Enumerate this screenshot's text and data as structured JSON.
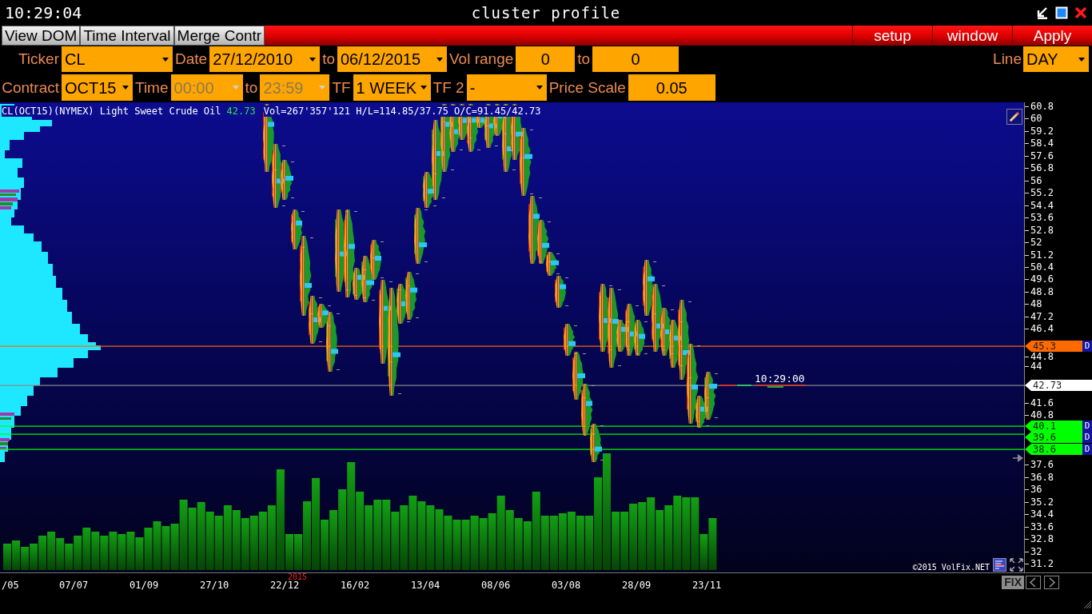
{
  "window": {
    "clock": "10:29:04",
    "title": "cluster profile"
  },
  "toolbar": {
    "buttons": [
      "View DOM",
      "Time Interval",
      "Merge Contr"
    ],
    "menu": [
      "setup",
      "window",
      "Apply"
    ]
  },
  "filters": [
    {
      "items": [
        {
          "kind": "label",
          "text": "Ticker"
        },
        {
          "kind": "dropdown",
          "value": "CL",
          "disabled": false
        },
        {
          "kind": "label",
          "text": "Date"
        },
        {
          "kind": "dropdown",
          "value": "27/12/2010",
          "disabled": false
        },
        {
          "kind": "label",
          "text": "to"
        },
        {
          "kind": "dropdown",
          "value": "06/12/2015",
          "disabled": false
        },
        {
          "kind": "label",
          "text": "Vol range"
        },
        {
          "kind": "field",
          "value": "0"
        },
        {
          "kind": "label",
          "text": "to"
        },
        {
          "kind": "field",
          "value": "0"
        }
      ],
      "right_items": [
        {
          "kind": "label",
          "text": "Line"
        },
        {
          "kind": "dropdown",
          "value": "DAY",
          "disabled": false
        }
      ]
    },
    {
      "items": [
        {
          "kind": "label",
          "text": "Contract"
        },
        {
          "kind": "dropdown",
          "value": "OCT15",
          "disabled": false
        },
        {
          "kind": "label",
          "text": "Time"
        },
        {
          "kind": "dropdown",
          "value": "00:00",
          "disabled": true
        },
        {
          "kind": "label",
          "text": "to"
        },
        {
          "kind": "dropdown",
          "value": "23:59",
          "disabled": true
        },
        {
          "kind": "label",
          "text": "TF"
        },
        {
          "kind": "dropdown",
          "value": "1 WEEK",
          "disabled": false
        },
        {
          "kind": "label",
          "text": "TF 2"
        },
        {
          "kind": "dropdown",
          "value": "-",
          "disabled": false
        },
        {
          "kind": "label",
          "text": "Price Scale"
        },
        {
          "kind": "field",
          "value": "0.05"
        }
      ]
    }
  ],
  "chart": {
    "header": {
      "instrument": "CL(OCT15)(NYMEX) Light Sweet Crude Oil",
      "last": "42.73",
      "stats": "Vol=267'357'121 H/L=114.85/37.75 O/C=91.45/42.73"
    },
    "price_axis": [
      "60.8",
      "60",
      "59.2",
      "58.4",
      "57.6",
      "56.8",
      "56",
      "55.2",
      "54.4",
      "53.6",
      "52.8",
      "52",
      "51.2",
      "50.4",
      "49.6",
      "48.8",
      "48",
      "47.2",
      "46.4",
      "44.8",
      "44",
      "41.6",
      "40.8",
      "37.6",
      "36.8",
      "36",
      "35.2",
      "34.4",
      "33.6",
      "32.8",
      "32",
      "31.2"
    ],
    "levels": [
      {
        "kind": "level",
        "label": "45.3",
        "color": "#ff6a00",
        "flag": "D"
      },
      {
        "kind": "current",
        "label": "42.73",
        "color": "#ffffff"
      },
      {
        "kind": "level",
        "label": "40.1",
        "color": "#00ff00",
        "flag": "D"
      },
      {
        "kind": "level",
        "label": "39.6",
        "color": "#00ff00",
        "flag": "D"
      },
      {
        "kind": "level",
        "label": "38.6",
        "color": "#00ff00",
        "flag": "D"
      }
    ],
    "time_marker": "10:29:00",
    "time_axis": [
      {
        "text": "/05"
      },
      {
        "text": "07/07"
      },
      {
        "text": "01/09"
      },
      {
        "text": "27/10"
      },
      {
        "text": "22/12",
        "year": "2015"
      },
      {
        "text": "16/02"
      },
      {
        "text": "13/04"
      },
      {
        "text": "08/06"
      },
      {
        "text": "03/08"
      },
      {
        "text": "28/09"
      },
      {
        "text": "23/11"
      }
    ],
    "copyright": "©2015 VolFix.NET"
  },
  "scroll_controls": {
    "fix": "FIX"
  }
}
